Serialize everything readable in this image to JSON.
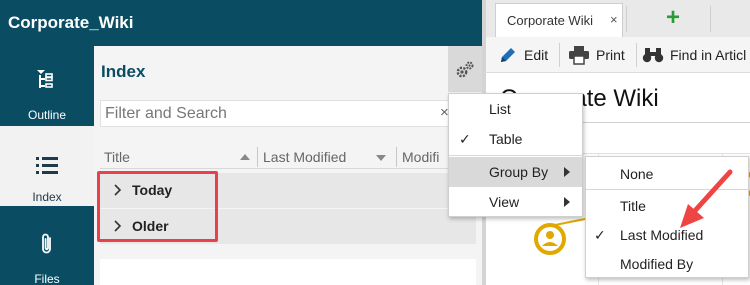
{
  "app": {
    "title": "Corporate_Wiki"
  },
  "rail": {
    "items": [
      {
        "label": "Outline",
        "icon": "outline-icon"
      },
      {
        "label": "Index",
        "icon": "list-icon",
        "active": true
      },
      {
        "label": "Files",
        "icon": "paperclip-icon"
      }
    ]
  },
  "index_panel": {
    "title": "Index",
    "search_placeholder": "Filter and Search",
    "search_clear": "×",
    "columns": [
      "Title",
      "Last Modified",
      "Modifi"
    ],
    "groups": [
      "Today",
      "Older"
    ]
  },
  "doc": {
    "tab_label": "Corporate Wiki",
    "tab_close": "×",
    "new_tab": "+",
    "toolbar": {
      "edit": "Edit",
      "print": "Print",
      "find": "Find in Articl"
    },
    "title": "Corporate Wiki"
  },
  "view_menu": {
    "items": [
      {
        "label": "List",
        "checked": false
      },
      {
        "label": "Table",
        "checked": true
      },
      {
        "label": "Group By",
        "submenu": true,
        "highlighted": true
      },
      {
        "label": "View",
        "submenu": true
      }
    ],
    "check_glyph": "✓"
  },
  "group_by_menu": {
    "items": [
      {
        "label": "None",
        "checked": false
      },
      {
        "label": "Title",
        "checked": false
      },
      {
        "label": "Last Modified",
        "checked": true
      },
      {
        "label": "Modified By",
        "checked": false
      }
    ],
    "check_glyph": "✓"
  },
  "colors": {
    "brand": "#0a4d63",
    "highlight_box": "#e8414b",
    "annotation_arrow": "#ee4444",
    "add_tab": "#2a9a35"
  }
}
